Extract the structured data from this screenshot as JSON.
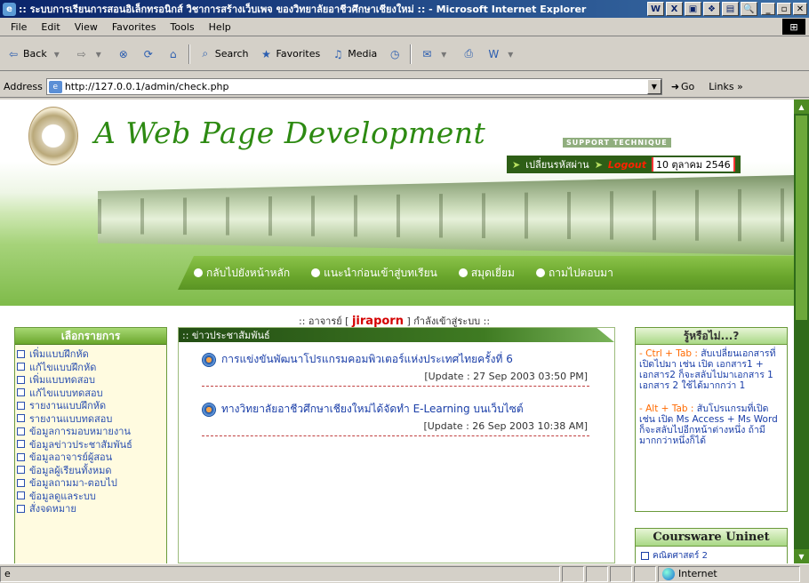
{
  "window": {
    "title": ":: ระบบการเรียนการสอนอิเล็กทรอนิกส์ วิชาการสร้างเว็บเพจ ของวิทยาลัยอาชีวศึกษาเชียงใหม่ :: - Microsoft Internet Explorer",
    "app_icon": "e",
    "tray_icons": [
      "W",
      "X",
      "▣",
      "❖",
      "▤",
      "🔍"
    ],
    "controls": [
      "_",
      "▫",
      "✕"
    ]
  },
  "menu": [
    "File",
    "Edit",
    "View",
    "Favorites",
    "Tools",
    "Help"
  ],
  "toolbar": {
    "back": "Back",
    "search": "Search",
    "favorites": "Favorites",
    "media": "Media"
  },
  "address": {
    "label": "Address",
    "url": "http://127.0.0.1/admin/check.php",
    "go": "Go",
    "links": "Links »"
  },
  "site": {
    "title": "A Web Page Development",
    "support": "SUPPORT TECHNIQUE",
    "change_password": "เปลี่ยนรหัสผ่าน",
    "logout": "Logout",
    "date": "10 ตุลาคม 2546",
    "nav": [
      "กลับไปยังหน้าหลัก",
      "แนะนำก่อนเข้าสู่บทเรียน",
      "สมุดเยี่ยม",
      "ถามไปตอบมา"
    ]
  },
  "welcome": {
    "prefix": ":: อาจารย์ [",
    "user": "jiraporn",
    "suffix": "] กำลังเข้าสู่ระบบ ::"
  },
  "left_menu": {
    "title": "เลือกรายการ",
    "items": [
      "เพิ่มแบบฝึกหัด",
      "แก้ไขแบบฝึกหัด",
      "เพิ่มแบบทดสอบ",
      "แก้ไขแบบทดสอบ",
      "รายงานแบบฝึกหัด",
      "รายงานแบบทดสอบ",
      "ข้อมูลการมอบหมายงาน",
      "ข้อมูลข่าวประชาสัมพันธ์",
      "ข้อมูลอาจารย์ผู้สอน",
      "ข้อมูลผู้เรียนทั้งหมด",
      "ข้อมูลถามมา-ตอบไป",
      "ข้อมูลดูแลระบบ",
      "สั่งจดหมาย"
    ]
  },
  "news": {
    "title": ":: ข่าวประชาสัมพันธ์",
    "items": [
      {
        "text": "การแข่งขันพัฒนาโปรแกรมคอมพิวเตอร์แห่งประเทศไทยครั้งที่ 6",
        "update": "[Update : 27 Sep 2003 03:50 PM]"
      },
      {
        "text": "ทางวิทยาลัยอาชีวศึกษาเชียงใหม่ได้จัดทำ E-Learning บนเว็บไซต์",
        "update": "[Update : 26 Sep 2003 10:38 AM]"
      }
    ]
  },
  "tips": {
    "title": "รู้หรือไม่...?",
    "items": [
      {
        "key": "- Ctrl + Tab :",
        "text": " สับเปลี่ยนเอกสารที่เปิดไปมา เช่น เปิด เอกสาร1 + เอกสาร2 ก็จะสลับไปมาเอกสาร 1 เอกสาร 2 ใช้ได้มากกว่า 1"
      },
      {
        "key": "- Alt + Tab :",
        "text": " สับโปรแกรมที่เปิด เช่น เปิด Ms Access + Ms Word ก็จะสลับไปอีกหน้าต่างหนึ่ง ถ้ามีมากกว่าหนึ่งก็ได้"
      }
    ]
  },
  "courseware": {
    "title": "Coursware Uninet",
    "first_item": "คณิตศาสตร์ 2"
  },
  "status": {
    "zone": "Internet"
  }
}
